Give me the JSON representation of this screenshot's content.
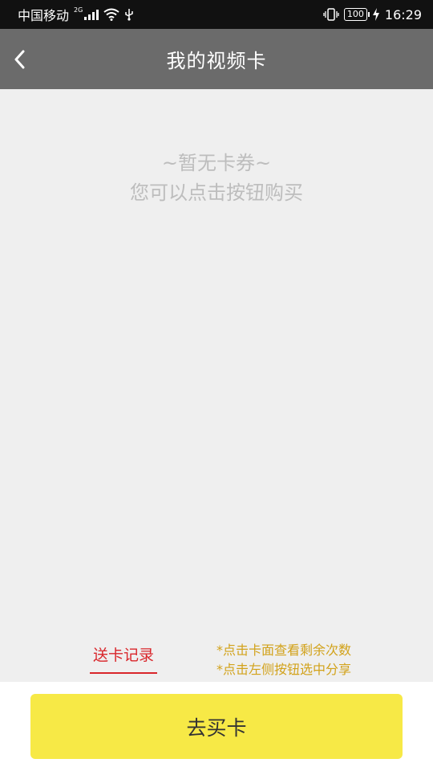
{
  "status_bar": {
    "carrier": "中国移动",
    "network": "2G",
    "battery": "100",
    "time": "16:29"
  },
  "header": {
    "title": "我的视频卡",
    "back_icon": "chevron-left-icon"
  },
  "empty_state": {
    "line1": "~暂无卡券~",
    "line2": "您可以点击按钮购买"
  },
  "footer": {
    "record_label": "送卡记录",
    "hint1": "*点击卡面查看剩余次数",
    "hint2": "*点击左侧按钮选中分享"
  },
  "actions": {
    "buy_label": "去买卡"
  },
  "colors": {
    "header_bg": "#6b6b6b",
    "buy_button_bg": "#f7e946",
    "record_color": "#d9262b",
    "hint_color": "#d2a21a"
  }
}
